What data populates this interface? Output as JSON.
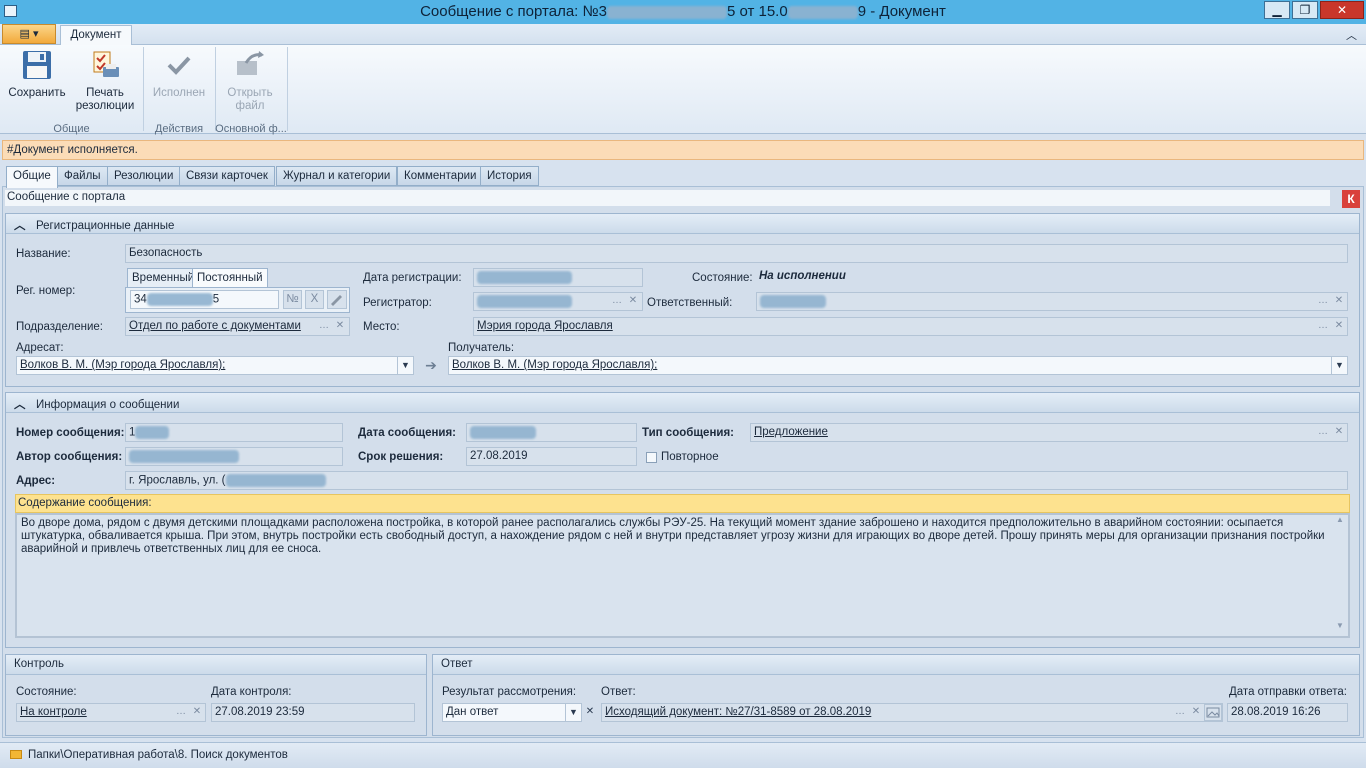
{
  "window": {
    "title_prefix": "Сообщение с портала: №3",
    "title_mid": "5 от 15.0",
    "title_suffix": "9 - Документ",
    "minimize": "▁",
    "restore": "❐",
    "close": "✕"
  },
  "ribbon": {
    "app_button": "▤ ▾",
    "tab": "Документ",
    "collapse": "︿",
    "buttons": {
      "save": "Сохранить",
      "print_line1": "Печать",
      "print_line2": "резолюции",
      "done": "Исполнен",
      "open_line1": "Открыть",
      "open_line2": "файл"
    },
    "groups": {
      "general": "Общие",
      "actions": "Действия",
      "main": "Основной ф..."
    }
  },
  "notice": "#Документ исполняется.",
  "tabs": [
    "Общие",
    "Файлы",
    "Резолюции",
    "Связи карточек",
    "Журнал и категории",
    "Комментарии",
    "История"
  ],
  "doc_header": {
    "type": "Сообщение с портала",
    "k_badge": "К"
  },
  "registration": {
    "section_title": "Регистрационные данные",
    "name_label": "Название:",
    "name_value": "Безопасность",
    "reg_label": "Рег. номер:",
    "subtab_temp": "Временный",
    "subtab_perm": "Постоянный",
    "reg_value_start": "34",
    "reg_value_end": "5",
    "reg_no_btn": "№",
    "reg_x_btn": "X",
    "reg_date_label": "Дата регистрации:",
    "registrar_label": "Регистратор:",
    "state_label": "Состояние:",
    "state_value": "На исполнении",
    "responsible_label": "Ответственный:",
    "division_label": "Подразделение:",
    "division_value": "Отдел по работе с документами",
    "place_label": "Место:",
    "place_value": "Мэрия города Ярославля",
    "addressee_label": "Адресат:",
    "addressee_value": "Волков В. М. (Мэр города Ярославля);",
    "recipient_label": "Получатель:",
    "recipient_value": "Волков В. М. (Мэр города Ярославля);",
    "arrow": "➔"
  },
  "message": {
    "section_title": "Информация о сообщении",
    "number_label": "Номер сообщения:",
    "number_value": "1",
    "date_label": "Дата сообщения:",
    "type_label": "Тип сообщения:",
    "type_value": "Предложение",
    "author_label": "Автор сообщения:",
    "deadline_label": "Срок решения:",
    "deadline_value": "27.08.2019",
    "repeat_label": "Повторное",
    "address_label": "Адрес:",
    "address_value": "г. Ярославль, ул. (",
    "content_label": "Содержание сообщения:",
    "content_text": "Во дворе дома, рядом с двумя детскими площадками расположена постройка, в которой ранее располагались службы РЭУ-25. На текущий момент здание заброшено и находится предположительно в аварийном состоянии: осыпается штукатурка, обваливается крыша. При этом, внутрь постройки есть свободный доступ, а нахождение рядом с ней и внутри представляет угрозу жизни для играющих во дворе детей. Прошу принять меры для организации признания постройки аварийной и привлечь ответственных лиц для ее сноса."
  },
  "control": {
    "title": "Контроль",
    "state_label": "Состояние:",
    "state_value": "На контроле",
    "date_label": "Дата контроля:",
    "date_value": "27.08.2019 23:59"
  },
  "answer": {
    "title": "Ответ",
    "result_label": "Результат рассмотрения:",
    "result_value": "Дан ответ",
    "answer_label": "Ответ:",
    "answer_value": "Исходящий документ: №27/31-8589 от 28.08.2019",
    "sent_label": "Дата отправки ответа:",
    "sent_value": "28.08.2019 16:26"
  },
  "status_bar": {
    "path": "Папки\\Оперативная работа\\8. Поиск документов"
  },
  "icons": {
    "save": "floppy-disk-icon",
    "print": "print-resolution-icon",
    "done": "checkmark-icon",
    "open": "open-file-icon",
    "ellipsis": "…",
    "clear": "✕",
    "dropdown": "▼",
    "collapse": "︿",
    "scroll_up": "▲",
    "scroll_down": "▼"
  },
  "colors": {
    "titlebar": "#52b3e5",
    "notice_bg": "#fbdcb7",
    "content_header_bg": "#fde28f",
    "close_button": "#c9372b",
    "k_badge": "#d9413b"
  }
}
